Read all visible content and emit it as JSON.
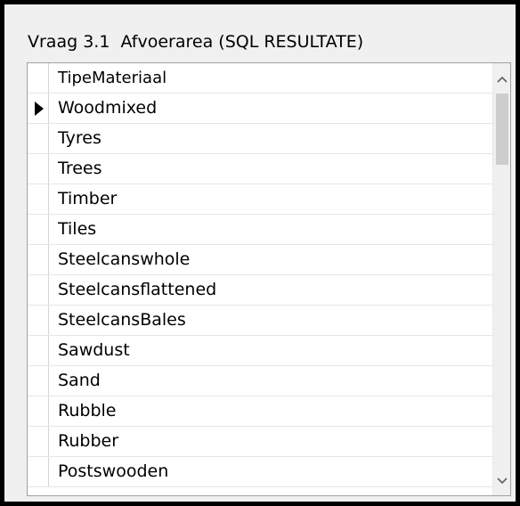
{
  "window": {
    "title": "Vraag 3.1  Afvoerarea (SQL RESULTATE)"
  },
  "grid": {
    "column_header": "TipeMateriaal",
    "current_row_index": 0,
    "rows": [
      "Woodmixed",
      "Tyres",
      "Trees",
      "Timber",
      "Tiles",
      "Steelcanswhole",
      "Steelcansflattened",
      "SteelcansBales",
      "Sawdust",
      "Sand",
      "Rubble",
      "Rubber",
      "Postswooden"
    ]
  },
  "scrollbar": {
    "up_icon": "chevron-up-icon",
    "down_icon": "chevron-down-icon",
    "position_fraction": 0
  }
}
